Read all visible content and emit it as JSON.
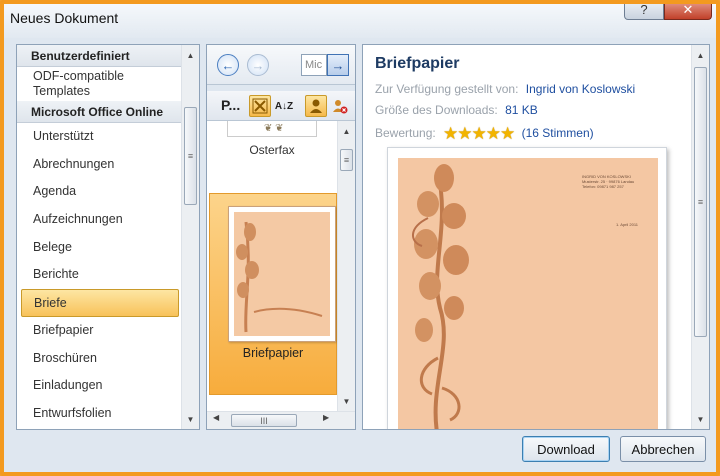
{
  "window": {
    "title": "Neues Dokument",
    "help_label": "?",
    "close_label": "✕"
  },
  "categories": {
    "header_custom": "Benutzerdefiniert",
    "odf_item": "ODF-compatible Templates",
    "header_online": "Microsoft Office Online",
    "items": [
      "Unterstützt",
      "Abrechnungen",
      "Agenda",
      "Aufzeichnungen",
      "Belege",
      "Berichte",
      "Briefe",
      "Briefpapier",
      "Broschüren",
      "Einladungen",
      "Entwurfsfolien"
    ],
    "selected": "Briefe"
  },
  "middle": {
    "nav_field_value": "Mic",
    "toolbar_label": "P...",
    "thumbnails": [
      {
        "name": "Osterfax"
      },
      {
        "name": "Briefpapier",
        "selected": true
      }
    ],
    "scroll_grip": "III"
  },
  "preview": {
    "title": "Briefpapier",
    "provided_by_label": "Zur Verfügung gestellt von:",
    "provided_by_value": "Ingrid von Koslowski",
    "size_label": "Größe des Downloads:",
    "size_value": "81 KB",
    "rating_label": "Bewertung:",
    "rating_stars": 5,
    "rating_votes": "(16 Stimmen)",
    "paper_color": "#f4c7a3",
    "letter_address": [
      "INGRID VON KOSLOWSKI",
      "Musterstr. 25 · 99876 Landau",
      "Telefon: 09871 987 257"
    ],
    "letter_date": "1. April 2011"
  },
  "buttons": {
    "download": "Download",
    "cancel": "Abbrechen"
  },
  "colors": {
    "accent_orange": "#f39a1f",
    "selection_gold": "#f8c25a",
    "link_blue": "#1f4fa0"
  }
}
